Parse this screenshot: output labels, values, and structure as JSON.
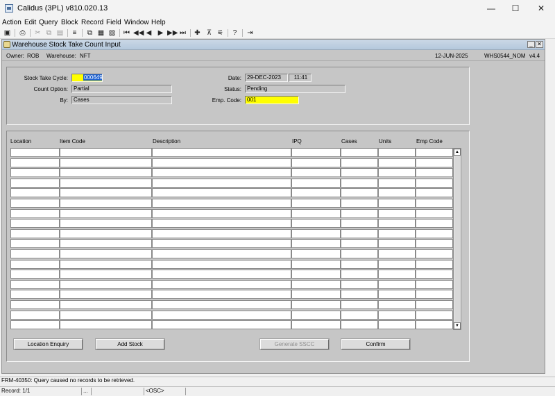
{
  "window": {
    "title": "Calidus (3PL) v810.020.13",
    "minimize": "—",
    "maximize": "☐",
    "close": "✕"
  },
  "menu": [
    "Action",
    "Edit",
    "Query",
    "Block",
    "Record",
    "Field",
    "Window",
    "Help"
  ],
  "toolbar_icons": [
    "save-icon",
    "print-icon",
    "cut-icon",
    "copy-icon",
    "paste-icon",
    "clear-icon",
    "duplicate-icon",
    "insert-icon",
    "remove-icon",
    "first-record-icon",
    "previous-block-icon",
    "previous-record-icon",
    "next-record-icon",
    "next-block-icon",
    "last-record-icon",
    "add-record-icon",
    "delete-record-icon",
    "lock-record-icon",
    "help-icon",
    "exit-icon"
  ],
  "form": {
    "title": "Warehouse Stock Take Count Input",
    "minimize": "_",
    "close": "✕",
    "info": {
      "owner_label": "Owner:",
      "owner": "ROB",
      "warehouse_label": "Warehouse:",
      "warehouse": "NFT",
      "date": "12-JUN-2025",
      "module": "WHS0544_NOM",
      "version": "v4.4"
    }
  },
  "header": {
    "stock_take_cycle_label": "Stock Take Cycle:",
    "stock_take_cycle": "000649",
    "count_option_label": "Count Option:",
    "count_option": "Partial",
    "by_label": "By:",
    "by": "Cases",
    "date_label": "Date:",
    "date": "29-DEC-2023",
    "time": "11:41",
    "status_label": "Status:",
    "status": "Pending",
    "emp_code_label": "Emp. Code:",
    "emp_code": "001"
  },
  "grid": {
    "columns": [
      "Location",
      "Item Code",
      "Description",
      "IPQ",
      "Cases",
      "Units",
      "Emp Code"
    ],
    "rows": [
      [
        "",
        "",
        "",
        "",
        "",
        "",
        ""
      ],
      [
        "",
        "",
        "",
        "",
        "",
        "",
        ""
      ],
      [
        "",
        "",
        "",
        "",
        "",
        "",
        ""
      ],
      [
        "",
        "",
        "",
        "",
        "",
        "",
        ""
      ],
      [
        "",
        "",
        "",
        "",
        "",
        "",
        ""
      ],
      [
        "",
        "",
        "",
        "",
        "",
        "",
        ""
      ],
      [
        "",
        "",
        "",
        "",
        "",
        "",
        ""
      ],
      [
        "",
        "",
        "",
        "",
        "",
        "",
        ""
      ],
      [
        "",
        "",
        "",
        "",
        "",
        "",
        ""
      ],
      [
        "",
        "",
        "",
        "",
        "",
        "",
        ""
      ],
      [
        "",
        "",
        "",
        "",
        "",
        "",
        ""
      ],
      [
        "",
        "",
        "",
        "",
        "",
        "",
        ""
      ],
      [
        "",
        "",
        "",
        "",
        "",
        "",
        ""
      ],
      [
        "",
        "",
        "",
        "",
        "",
        "",
        ""
      ],
      [
        "",
        "",
        "",
        "",
        "",
        "",
        ""
      ],
      [
        "",
        "",
        "",
        "",
        "",
        "",
        ""
      ],
      [
        "",
        "",
        "",
        "",
        "",
        "",
        ""
      ],
      [
        "",
        "",
        "",
        "",
        "",
        "",
        ""
      ]
    ],
    "scroll_up": "▲",
    "scroll_down": "▼"
  },
  "buttons": {
    "location_enquiry": "Location Enquiry",
    "add_stock": "Add Stock",
    "generate_sscc": "Generate SSCC",
    "confirm": "Confirm"
  },
  "status": {
    "message": "FRM-40350: Query caused no records to be retrieved.",
    "record": "Record: 1/1",
    "segment2": "...",
    "osc": "<OSC>"
  }
}
